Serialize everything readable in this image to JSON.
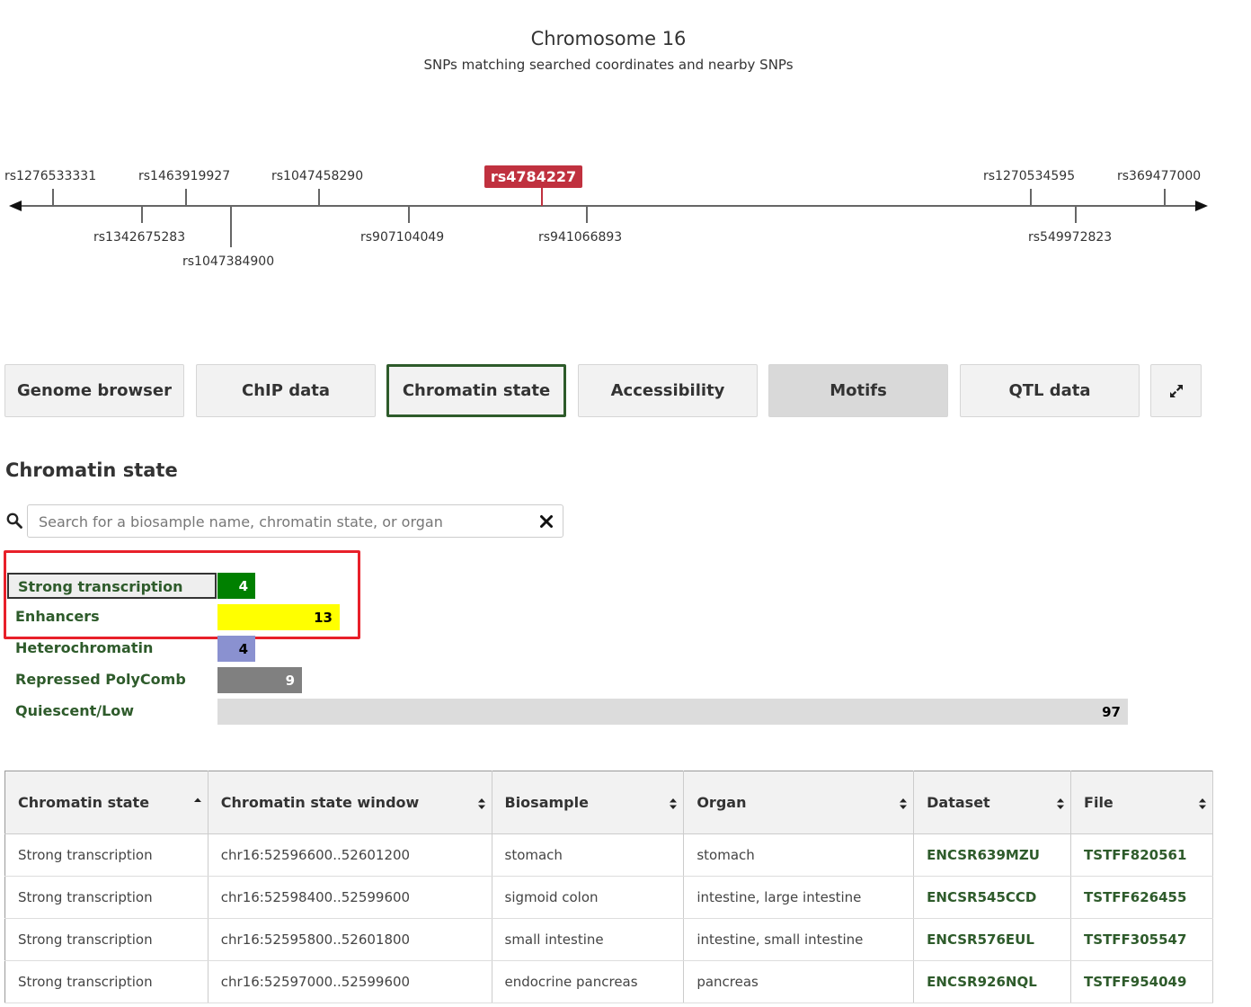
{
  "header": {
    "title": "Chromosome 16",
    "subtitle": "SNPs matching searched coordinates and nearby SNPs"
  },
  "snp_axis": {
    "focus_snp": "rs4784227",
    "focus_color": "#c0313f",
    "above": [
      "rs1276533331",
      "rs1463919927",
      "rs1047458290",
      "rs1270534595",
      "rs369477000"
    ],
    "below": [
      "rs1342675283",
      "rs1047384900",
      "rs907104049",
      "rs941066893",
      "rs549972823"
    ]
  },
  "tabs": [
    {
      "label": "Genome browser"
    },
    {
      "label": "ChIP data"
    },
    {
      "label": "Chromatin state",
      "active": true
    },
    {
      "label": "Accessibility"
    },
    {
      "label": "Motifs"
    },
    {
      "label": "QTL data"
    }
  ],
  "expand_icon": "expand-arrows-icon",
  "section": {
    "title": "Chromatin state",
    "search": {
      "placeholder": "Search for a biosample name, chromatin state, or organ",
      "value": ""
    }
  },
  "facets": [
    {
      "label": "Strong transcription",
      "count": "4",
      "value": 4,
      "color": "#008000",
      "text_color": "#ffffff",
      "selected": true
    },
    {
      "label": "Enhancers",
      "count": "13",
      "value": 13,
      "color": "#ffff00",
      "text_color": "#000000"
    },
    {
      "label": "Heterochromatin",
      "count": "4",
      "value": 4,
      "color": "#8a91d0",
      "text_color": "#000000"
    },
    {
      "label": "Repressed PolyComb",
      "count": "9",
      "value": 9,
      "color": "#808080",
      "text_color": "#ffffff"
    },
    {
      "label": "Quiescent/Low",
      "count": "97",
      "value": 97,
      "color": "#dcdcdc",
      "text_color": "#000000"
    }
  ],
  "table": {
    "columns": [
      "Chromatin state",
      "Chromatin state window",
      "Biosample",
      "Organ",
      "Dataset",
      "File"
    ],
    "rows": [
      [
        "Strong transcription",
        "chr16:52596600..52601200",
        "stomach",
        "stomach",
        "ENCSR639MZU",
        "TSTFF820561"
      ],
      [
        "Strong transcription",
        "chr16:52598400..52599600",
        "sigmoid colon",
        "intestine, large intestine",
        "ENCSR545CCD",
        "TSTFF626455"
      ],
      [
        "Strong transcription",
        "chr16:52595800..52601800",
        "small intestine",
        "intestine, small intestine",
        "ENCSR576EUL",
        "TSTFF305547"
      ],
      [
        "Strong transcription",
        "chr16:52597000..52599600",
        "endocrine pancreas",
        "pancreas",
        "ENCSR926NQL",
        "TSTFF954049"
      ]
    ]
  }
}
